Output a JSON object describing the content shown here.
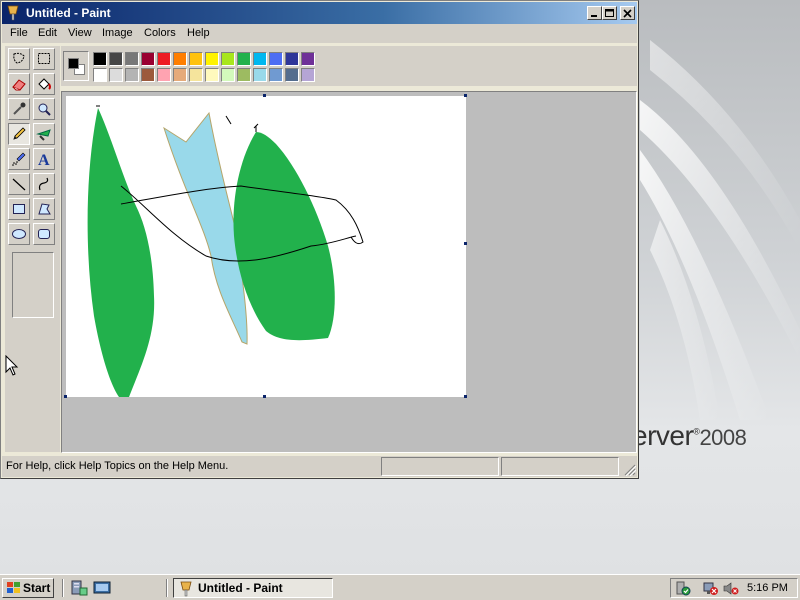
{
  "window": {
    "title": "Untitled - Paint"
  },
  "menu": {
    "items": [
      "File",
      "Edit",
      "View",
      "Image",
      "Colors",
      "Help"
    ]
  },
  "toolbox": {
    "tools": [
      "free-form-select",
      "select",
      "eraser",
      "fill-with-color",
      "pick-color",
      "magnifier",
      "pencil",
      "brush",
      "airbrush",
      "text",
      "line",
      "curve",
      "rectangle",
      "polygon",
      "ellipse",
      "rounded-rectangle"
    ],
    "selected": "pencil"
  },
  "palette": {
    "foreground": "#000000",
    "background": "#ffffff",
    "row1": [
      "#000000",
      "#464646",
      "#787878",
      "#990030",
      "#ed1c24",
      "#ff7e00",
      "#ffc20e",
      "#fff200",
      "#a8e61d",
      "#22b14c",
      "#00b7ef",
      "#4d6df3",
      "#2f3699",
      "#6f3198"
    ],
    "row2": [
      "#ffffff",
      "#dcdcdc",
      "#b4b4b4",
      "#9c5a3c",
      "#ffa3b1",
      "#e5aa7a",
      "#f5e49c",
      "#fff9bd",
      "#d3f9bc",
      "#9dbb61",
      "#99d9ea",
      "#709ad1",
      "#546d8e",
      "#b5a5d5"
    ]
  },
  "canvas": {
    "colors": {
      "green": "#22b14c",
      "light_blue": "#99d9ea",
      "outline": "#b5a56a",
      "stroke": "#000000"
    }
  },
  "status": {
    "help_text": "For Help, click Help Topics on the Help Menu."
  },
  "desktop": {
    "brand_text": "erver",
    "brand_mark": "®",
    "brand_year": "2008"
  },
  "taskbar": {
    "start_label": "Start",
    "quick_launch": [
      "server-manager-icon",
      "show-desktop-icon"
    ],
    "active_task": "Untitled - Paint",
    "tray_icons": [
      "security-icon",
      "network-disconnected-icon",
      "volume-muted-icon"
    ],
    "clock": "5:16 PM"
  }
}
